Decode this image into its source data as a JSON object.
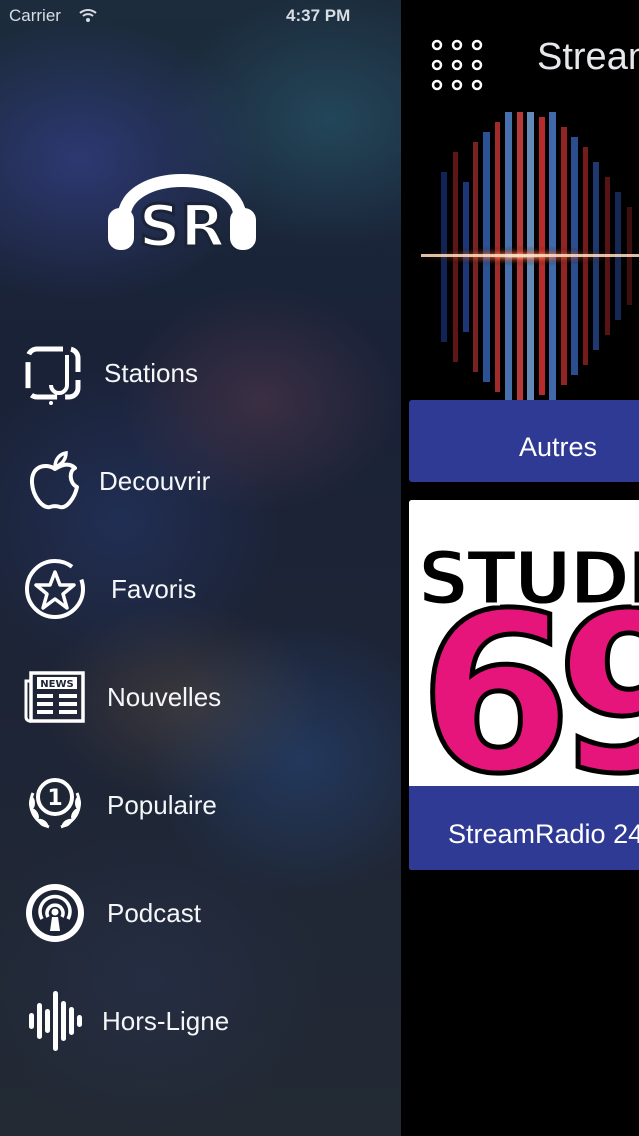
{
  "status_bar": {
    "carrier": "Carrier",
    "time": "4:37 PM"
  },
  "drawer": {
    "logo_text": "SR",
    "menu": [
      {
        "label": "Stations",
        "icon": "stations-icon"
      },
      {
        "label": "Decouvrir",
        "icon": "apple-icon"
      },
      {
        "label": "Favoris",
        "icon": "star-icon"
      },
      {
        "label": "Nouvelles",
        "icon": "newspaper-icon",
        "icon_text": "NEWS"
      },
      {
        "label": "Populaire",
        "icon": "laurel-number-one-icon",
        "icon_text": "1"
      },
      {
        "label": "Podcast",
        "icon": "podcast-icon"
      },
      {
        "label": "Hors-Ligne",
        "icon": "waveform-icon"
      }
    ]
  },
  "main": {
    "header_title": "Stream",
    "menu_icon": "grid-dots-icon",
    "cards": [
      {
        "label": "Autres"
      },
      {
        "label": "StreamRadio 24",
        "art_text_top": "STUDI",
        "art_text_bottom": "69"
      }
    ]
  },
  "colors": {
    "card_bar": "#2e3a93",
    "studio_pink": "#e5157c"
  }
}
